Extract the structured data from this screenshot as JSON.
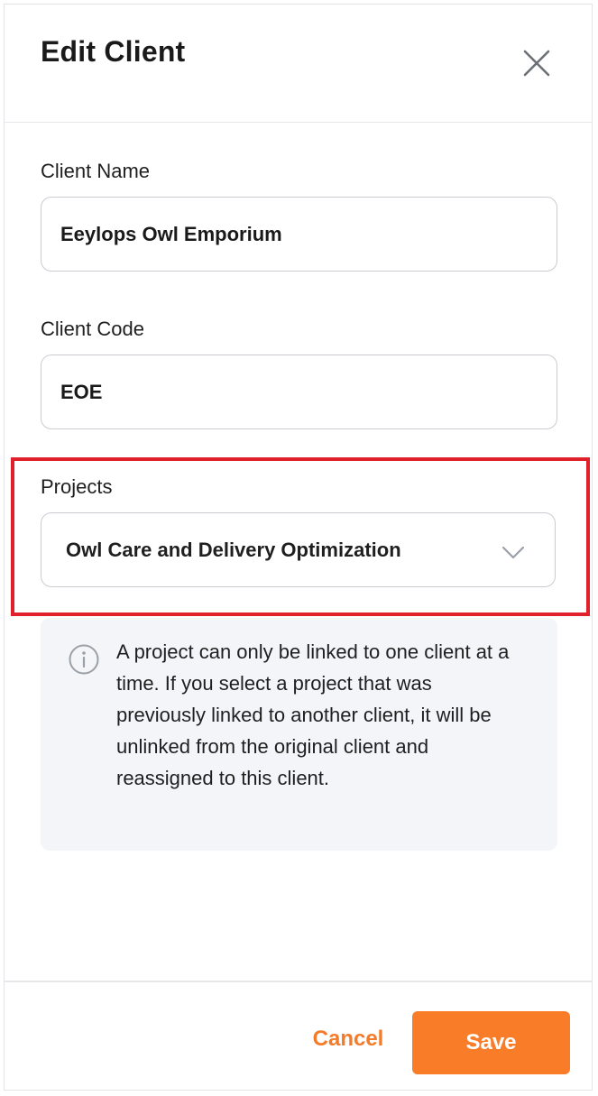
{
  "dialog": {
    "title": "Edit Client",
    "close_icon": "close-icon"
  },
  "form": {
    "client_name": {
      "label": "Client Name",
      "value": "Eeylops Owl Emporium"
    },
    "client_code": {
      "label": "Client Code",
      "value": "EOE"
    },
    "projects": {
      "label": "Projects",
      "selected": "Owl Care and Delivery Optimization",
      "icon": "chevron-down-icon"
    }
  },
  "info": {
    "icon": "info-icon",
    "text": "A project can only be linked to one client at a time. If you select a project that was previously linked to another client, it will be unlinked from the original client and reassigned to this client."
  },
  "footer": {
    "cancel_label": "Cancel",
    "save_label": "Save"
  },
  "colors": {
    "accent": "#f97d28",
    "highlight": "#e0202a",
    "info_bg": "#f4f5f9"
  }
}
